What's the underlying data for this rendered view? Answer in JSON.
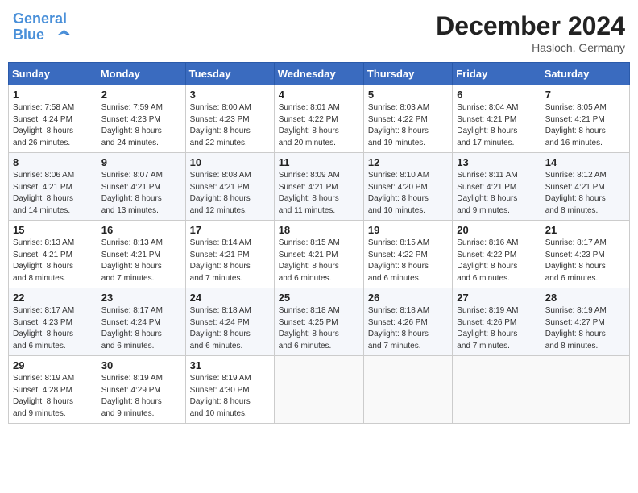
{
  "header": {
    "logo_line1": "General",
    "logo_line2": "Blue",
    "month_title": "December 2024",
    "subtitle": "Hasloch, Germany"
  },
  "weekdays": [
    "Sunday",
    "Monday",
    "Tuesday",
    "Wednesday",
    "Thursday",
    "Friday",
    "Saturday"
  ],
  "weeks": [
    [
      {
        "day": "1",
        "info": "Sunrise: 7:58 AM\nSunset: 4:24 PM\nDaylight: 8 hours\nand 26 minutes."
      },
      {
        "day": "2",
        "info": "Sunrise: 7:59 AM\nSunset: 4:23 PM\nDaylight: 8 hours\nand 24 minutes."
      },
      {
        "day": "3",
        "info": "Sunrise: 8:00 AM\nSunset: 4:23 PM\nDaylight: 8 hours\nand 22 minutes."
      },
      {
        "day": "4",
        "info": "Sunrise: 8:01 AM\nSunset: 4:22 PM\nDaylight: 8 hours\nand 20 minutes."
      },
      {
        "day": "5",
        "info": "Sunrise: 8:03 AM\nSunset: 4:22 PM\nDaylight: 8 hours\nand 19 minutes."
      },
      {
        "day": "6",
        "info": "Sunrise: 8:04 AM\nSunset: 4:21 PM\nDaylight: 8 hours\nand 17 minutes."
      },
      {
        "day": "7",
        "info": "Sunrise: 8:05 AM\nSunset: 4:21 PM\nDaylight: 8 hours\nand 16 minutes."
      }
    ],
    [
      {
        "day": "8",
        "info": "Sunrise: 8:06 AM\nSunset: 4:21 PM\nDaylight: 8 hours\nand 14 minutes."
      },
      {
        "day": "9",
        "info": "Sunrise: 8:07 AM\nSunset: 4:21 PM\nDaylight: 8 hours\nand 13 minutes."
      },
      {
        "day": "10",
        "info": "Sunrise: 8:08 AM\nSunset: 4:21 PM\nDaylight: 8 hours\nand 12 minutes."
      },
      {
        "day": "11",
        "info": "Sunrise: 8:09 AM\nSunset: 4:21 PM\nDaylight: 8 hours\nand 11 minutes."
      },
      {
        "day": "12",
        "info": "Sunrise: 8:10 AM\nSunset: 4:20 PM\nDaylight: 8 hours\nand 10 minutes."
      },
      {
        "day": "13",
        "info": "Sunrise: 8:11 AM\nSunset: 4:21 PM\nDaylight: 8 hours\nand 9 minutes."
      },
      {
        "day": "14",
        "info": "Sunrise: 8:12 AM\nSunset: 4:21 PM\nDaylight: 8 hours\nand 8 minutes."
      }
    ],
    [
      {
        "day": "15",
        "info": "Sunrise: 8:13 AM\nSunset: 4:21 PM\nDaylight: 8 hours\nand 8 minutes."
      },
      {
        "day": "16",
        "info": "Sunrise: 8:13 AM\nSunset: 4:21 PM\nDaylight: 8 hours\nand 7 minutes."
      },
      {
        "day": "17",
        "info": "Sunrise: 8:14 AM\nSunset: 4:21 PM\nDaylight: 8 hours\nand 7 minutes."
      },
      {
        "day": "18",
        "info": "Sunrise: 8:15 AM\nSunset: 4:21 PM\nDaylight: 8 hours\nand 6 minutes."
      },
      {
        "day": "19",
        "info": "Sunrise: 8:15 AM\nSunset: 4:22 PM\nDaylight: 8 hours\nand 6 minutes."
      },
      {
        "day": "20",
        "info": "Sunrise: 8:16 AM\nSunset: 4:22 PM\nDaylight: 8 hours\nand 6 minutes."
      },
      {
        "day": "21",
        "info": "Sunrise: 8:17 AM\nSunset: 4:23 PM\nDaylight: 8 hours\nand 6 minutes."
      }
    ],
    [
      {
        "day": "22",
        "info": "Sunrise: 8:17 AM\nSunset: 4:23 PM\nDaylight: 8 hours\nand 6 minutes."
      },
      {
        "day": "23",
        "info": "Sunrise: 8:17 AM\nSunset: 4:24 PM\nDaylight: 8 hours\nand 6 minutes."
      },
      {
        "day": "24",
        "info": "Sunrise: 8:18 AM\nSunset: 4:24 PM\nDaylight: 8 hours\nand 6 minutes."
      },
      {
        "day": "25",
        "info": "Sunrise: 8:18 AM\nSunset: 4:25 PM\nDaylight: 8 hours\nand 6 minutes."
      },
      {
        "day": "26",
        "info": "Sunrise: 8:18 AM\nSunset: 4:26 PM\nDaylight: 8 hours\nand 7 minutes."
      },
      {
        "day": "27",
        "info": "Sunrise: 8:19 AM\nSunset: 4:26 PM\nDaylight: 8 hours\nand 7 minutes."
      },
      {
        "day": "28",
        "info": "Sunrise: 8:19 AM\nSunset: 4:27 PM\nDaylight: 8 hours\nand 8 minutes."
      }
    ],
    [
      {
        "day": "29",
        "info": "Sunrise: 8:19 AM\nSunset: 4:28 PM\nDaylight: 8 hours\nand 9 minutes."
      },
      {
        "day": "30",
        "info": "Sunrise: 8:19 AM\nSunset: 4:29 PM\nDaylight: 8 hours\nand 9 minutes."
      },
      {
        "day": "31",
        "info": "Sunrise: 8:19 AM\nSunset: 4:30 PM\nDaylight: 8 hours\nand 10 minutes."
      },
      {
        "day": "",
        "info": ""
      },
      {
        "day": "",
        "info": ""
      },
      {
        "day": "",
        "info": ""
      },
      {
        "day": "",
        "info": ""
      }
    ]
  ]
}
